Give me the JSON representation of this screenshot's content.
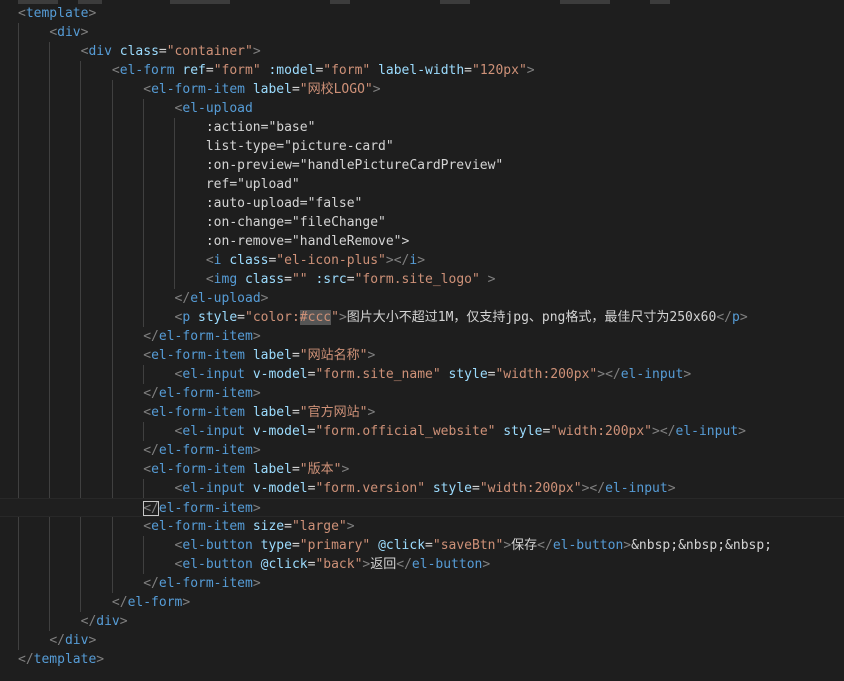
{
  "editor": {
    "language": "vue-html",
    "theme_colors": {
      "background": "#1e1e1e",
      "tag": "#569cd6",
      "attribute": "#9cdcfe",
      "string": "#ce9178",
      "text": "#d4d4d4",
      "bracket": "#808080"
    },
    "code_lines": [
      "<template>",
      "    <div>",
      "        <div class=\"container\">",
      "            <el-form ref=\"form\" :model=\"form\" label-width=\"120px\">",
      "                <el-form-item label=\"网校LOGO\">",
      "                    <el-upload",
      "                        :action=\"base\"",
      "                        list-type=\"picture-card\"",
      "                        :on-preview=\"handlePictureCardPreview\"",
      "                        ref=\"upload\"",
      "                        :auto-upload=\"false\"",
      "                        :on-change=\"fileChange\"",
      "                        :on-remove=\"handleRemove\">",
      "                        <i class=\"el-icon-plus\"></i>",
      "                        <img class=\"\" :src=\"form.site_logo\" >",
      "                    </el-upload>",
      "                    <p style=\"color:#ccc\">图片大小不超过1M，仅支持jpg、png格式，最佳尺寸为250x60</p>",
      "                </el-form-item>",
      "                <el-form-item label=\"网站名称\">",
      "                    <el-input v-model=\"form.site_name\" style=\"width:200px\"></el-input>",
      "                </el-form-item>",
      "                <el-form-item label=\"官方网站\">",
      "                    <el-input v-model=\"form.official_website\" style=\"width:200px\"></el-input>",
      "                </el-form-item>",
      "                <el-form-item label=\"版本\">",
      "                    <el-input v-model=\"form.version\" style=\"width:200px\"></el-input>",
      "                </el-form-item>",
      "                <el-form-item size=\"large\">",
      "                    <el-button type=\"primary\" @click=\"saveBtn\">保存</el-button>&nbsp;&nbsp;&nbsp;",
      "                    <el-button @click=\"back\">返回</el-button>",
      "                </el-form-item>",
      "            </el-form>",
      "        </div>",
      "    </div>",
      "</template>"
    ]
  }
}
